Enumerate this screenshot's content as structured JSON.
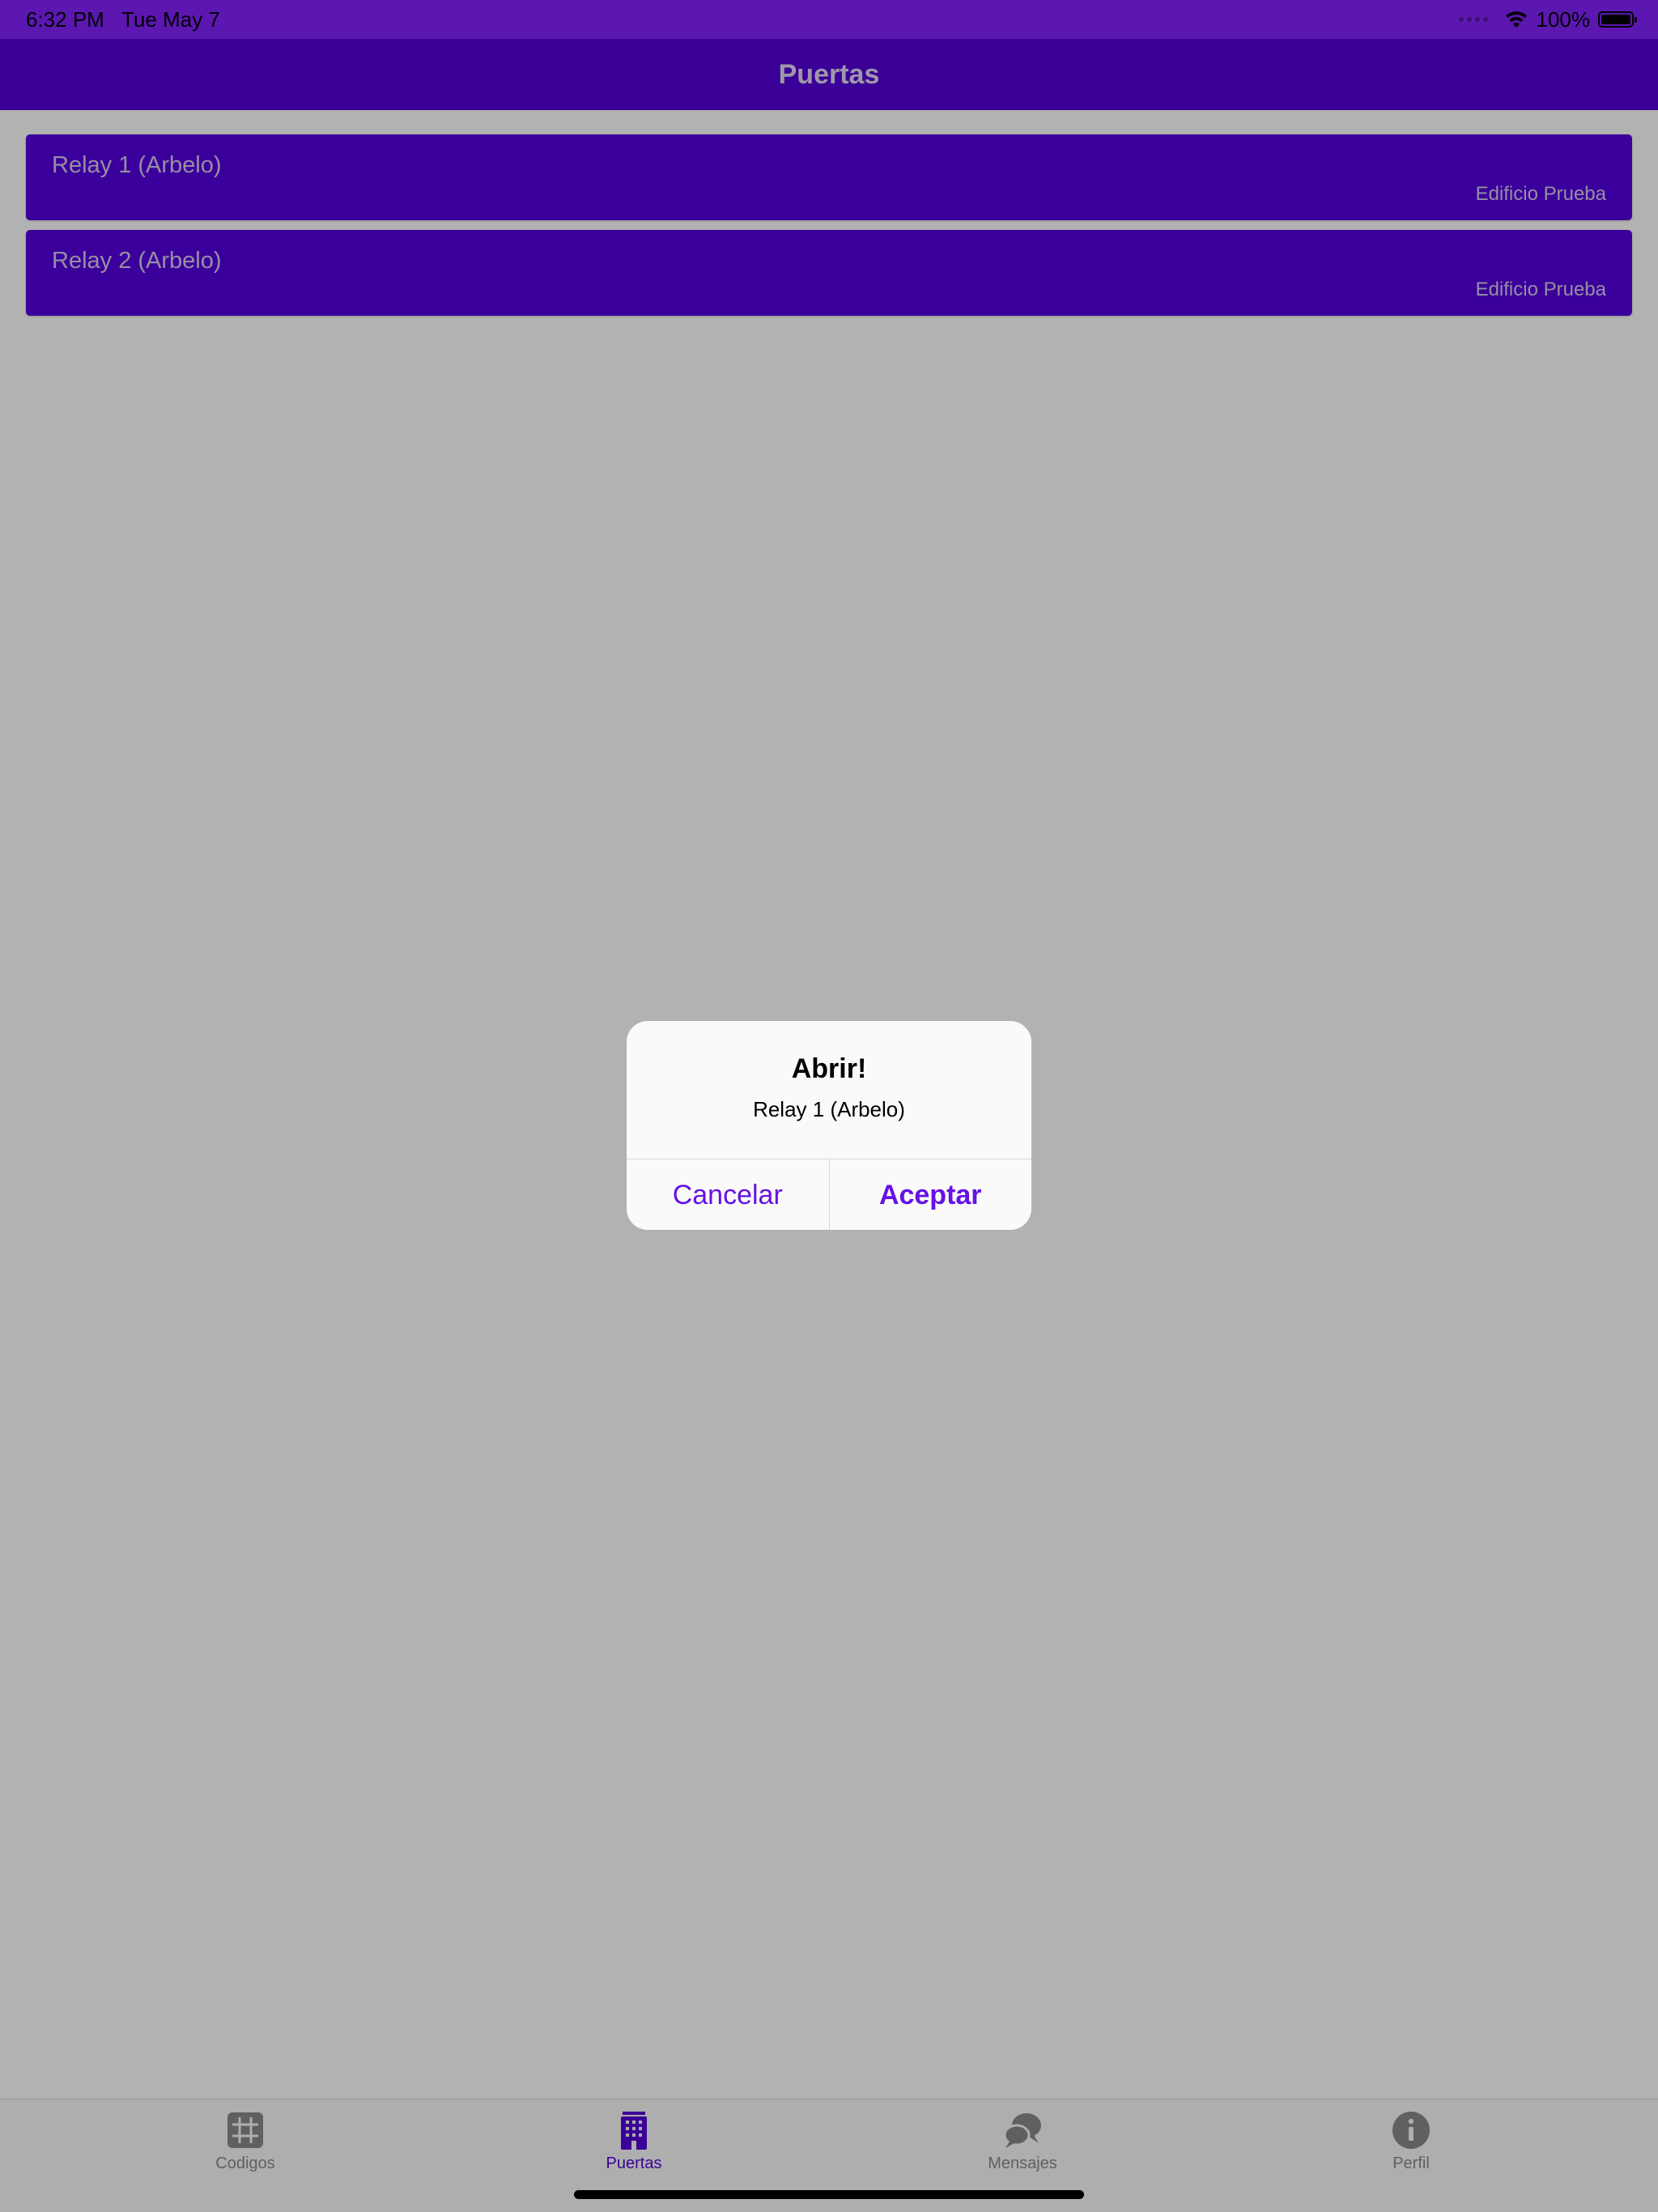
{
  "status_bar": {
    "time": "6:32 PM",
    "date": "Tue May 7",
    "battery": "100%"
  },
  "nav": {
    "title": "Puertas"
  },
  "doors": [
    {
      "name": "Relay 1 (Arbelo)",
      "building": "Edificio Prueba"
    },
    {
      "name": "Relay 2 (Arbelo)",
      "building": "Edificio Prueba"
    }
  ],
  "tabs": [
    {
      "label": "Codigos",
      "icon": "grid-icon",
      "active": false
    },
    {
      "label": "Puertas",
      "icon": "building-icon",
      "active": true
    },
    {
      "label": "Mensajes",
      "icon": "chat-bubbles-icon",
      "active": false
    },
    {
      "label": "Perfil",
      "icon": "info-icon",
      "active": false
    }
  ],
  "dialog": {
    "title": "Abrir!",
    "message": "Relay 1 (Arbelo)",
    "cancel_label": "Cancelar",
    "accept_label": "Aceptar"
  },
  "colors": {
    "status_bar": "#8522fe",
    "nav_bar": "#5500d8",
    "card": "#5500e0",
    "accent": "#6611e6"
  }
}
